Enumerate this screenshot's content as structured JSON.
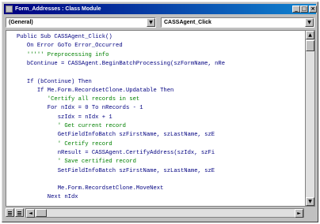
{
  "window": {
    "title": "Form_Addresses : Class Module",
    "minimize_glyph": "_",
    "maximize_glyph": "□",
    "close_glyph": "×"
  },
  "object_combo": {
    "value": "(General)",
    "arrow": "▼"
  },
  "procedure_combo": {
    "value": "CASSAgent_Click",
    "arrow": "▼"
  },
  "scrollbar": {
    "up": "▲",
    "down": "▼",
    "left": "◄",
    "right": "►"
  },
  "code": {
    "lines": [
      {
        "text": "   Public Sub CASSAgent_Click()",
        "kind": "code"
      },
      {
        "text": "      On Error GoTo Error_Occurred",
        "kind": "code"
      },
      {
        "text": "      ''''' Preprocessing info",
        "kind": "comment"
      },
      {
        "text": "      bContinue = CASSAgent.BeginBatchProcessing(szFormName, nRe",
        "kind": "code"
      },
      {
        "text": "",
        "kind": "code"
      },
      {
        "text": "      If (bContinue) Then",
        "kind": "code"
      },
      {
        "text": "         If Me.Form.RecordsetClone.Updatable Then",
        "kind": "code"
      },
      {
        "text": "            'Certify all records in set",
        "kind": "comment"
      },
      {
        "text": "            For nIdx = 0 To nRecords - 1",
        "kind": "code"
      },
      {
        "text": "               szIdx = nIdx + 1",
        "kind": "code"
      },
      {
        "text": "               ' Get current record",
        "kind": "comment"
      },
      {
        "text": "               GetFieldInfoBatch szFirstName, szLastName, szE",
        "kind": "code"
      },
      {
        "text": "               ' Certify record",
        "kind": "comment"
      },
      {
        "text": "               nResult = CASSAgent.CertifyAddress(szIdx, szFi",
        "kind": "code"
      },
      {
        "text": "               ' Save certified record",
        "kind": "comment"
      },
      {
        "text": "               SetFieldInfoBatch szFirstName, szLastName, szE",
        "kind": "code"
      },
      {
        "text": "",
        "kind": "code"
      },
      {
        "text": "               Me.Form.RecordsetClone.MoveNext",
        "kind": "code"
      },
      {
        "text": "            Next nIdx",
        "kind": "code"
      }
    ]
  }
}
